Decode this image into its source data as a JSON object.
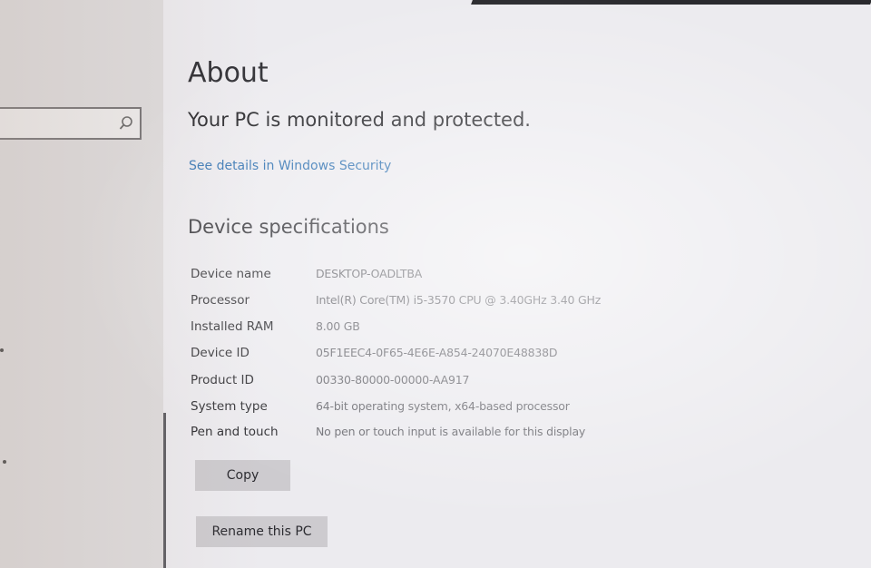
{
  "window": {
    "page_title": "About"
  },
  "sidebar": {
    "search": {
      "value": "",
      "icon": "search-icon"
    }
  },
  "security": {
    "status_text": "Your PC is monitored and protected.",
    "link_text": "See details in Windows Security"
  },
  "device_specs": {
    "heading": "Device specifications",
    "rows": [
      {
        "label": "Device name",
        "value": "DESKTOP-OADLTBA"
      },
      {
        "label": "Processor",
        "value": "Intel(R) Core(TM) i5-3570 CPU @ 3.40GHz   3.40 GHz"
      },
      {
        "label": "Installed RAM",
        "value": "8.00 GB"
      },
      {
        "label": "Device ID",
        "value": "05F1EEC4-0F65-4E6E-A854-24070E48838D"
      },
      {
        "label": "Product ID",
        "value": "00330-80000-00000-AA917"
      },
      {
        "label": "System type",
        "value": "64-bit operating system, x64-based processor"
      },
      {
        "label": "Pen and touch",
        "value": "No pen or touch input is available for this display"
      }
    ],
    "copy_label": "Copy"
  },
  "actions": {
    "rename_label": "Rename this PC"
  },
  "colors": {
    "link": "#2c6fb0",
    "button_bg": "#cdcbcf",
    "background": "#ecebef"
  }
}
